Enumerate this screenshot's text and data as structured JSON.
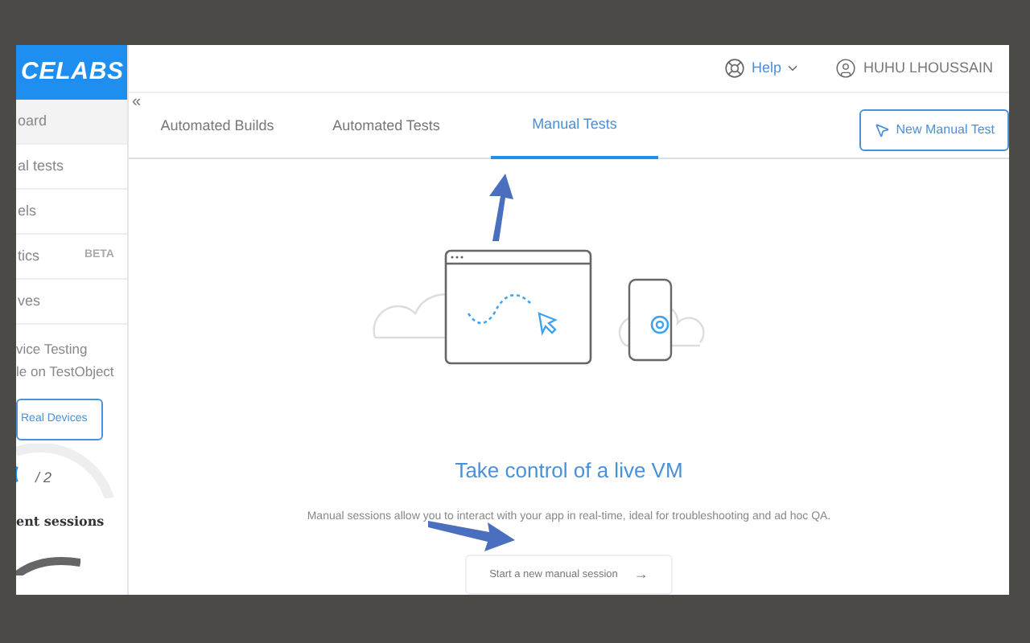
{
  "logo": "CELABS",
  "sidebar": {
    "items": [
      {
        "label": "oard",
        "selected": true
      },
      {
        "label": "al tests",
        "selected": false
      },
      {
        "label": "els",
        "selected": false
      },
      {
        "label": "tics",
        "badge": "BETA",
        "selected": false
      },
      {
        "label": "ves",
        "selected": false
      }
    ],
    "promo_lines": [
      "vice Testing",
      "le on TestObject"
    ],
    "promo_button": "Real Devices",
    "sessions_count": "/ 2",
    "sessions_label": "ent sessions"
  },
  "header": {
    "help": "Help",
    "user": "HUHU LHOUSSAIN"
  },
  "collapse": "«",
  "tabs": [
    {
      "label": "Automated Builds",
      "selected": false
    },
    {
      "label": "Automated Tests",
      "selected": false
    },
    {
      "label": "Manual Tests",
      "selected": true
    }
  ],
  "new_button": "New Manual Test",
  "hero": {
    "title": "Take control of a live VM",
    "description": "Manual sessions allow you to interact with your app in real-time, ideal for troubleshooting and ad hoc QA.",
    "cta": "Start a new manual session",
    "cta_arrow": "→"
  }
}
